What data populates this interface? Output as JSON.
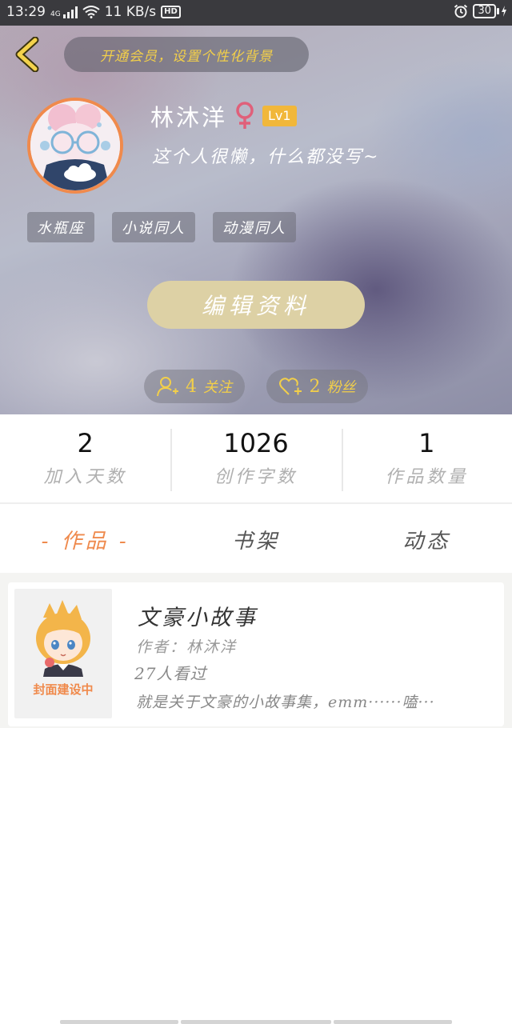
{
  "status_bar": {
    "time": "13:29",
    "network_type": "4G",
    "speed": "11 KB/s",
    "hd": "HD",
    "battery": "30"
  },
  "header": {
    "vip_banner": "开通会员，设置个性化背景"
  },
  "profile": {
    "name": "林沐洋",
    "level": "Lv1",
    "bio": "这个人很懒，什么都没写~",
    "tags": [
      "水瓶座",
      "小说同人",
      "动漫同人"
    ],
    "edit_button": "编辑资料",
    "following_count": "4",
    "following_label": "关注",
    "fans_count": "2",
    "fans_label": "粉丝"
  },
  "stats": [
    {
      "value": "2",
      "label": "加入天数"
    },
    {
      "value": "1026",
      "label": "创作字数"
    },
    {
      "value": "1",
      "label": "作品数量"
    }
  ],
  "tabs": [
    "- 作品 -",
    "书架",
    "动态"
  ],
  "works": [
    {
      "cover_caption": "封面建设中",
      "title": "文豪小故事",
      "author": "作者：林沐洋",
      "views": "27人看过",
      "description": "就是关于文豪的小故事集，emm······嗑···"
    }
  ],
  "colors": {
    "accent": "#ef8a4d",
    "gold": "#f2cf4a",
    "edit_button": "#ddd1a5",
    "level_badge": "#f1b73a",
    "female": "#e0607a"
  },
  "icons": {
    "back": "chevron-left-icon",
    "gender": "female-icon",
    "following": "add-user-icon",
    "fans": "heart-plus-icon",
    "alarm": "alarm-icon",
    "wifi": "wifi-icon",
    "signal": "signal-icon"
  }
}
